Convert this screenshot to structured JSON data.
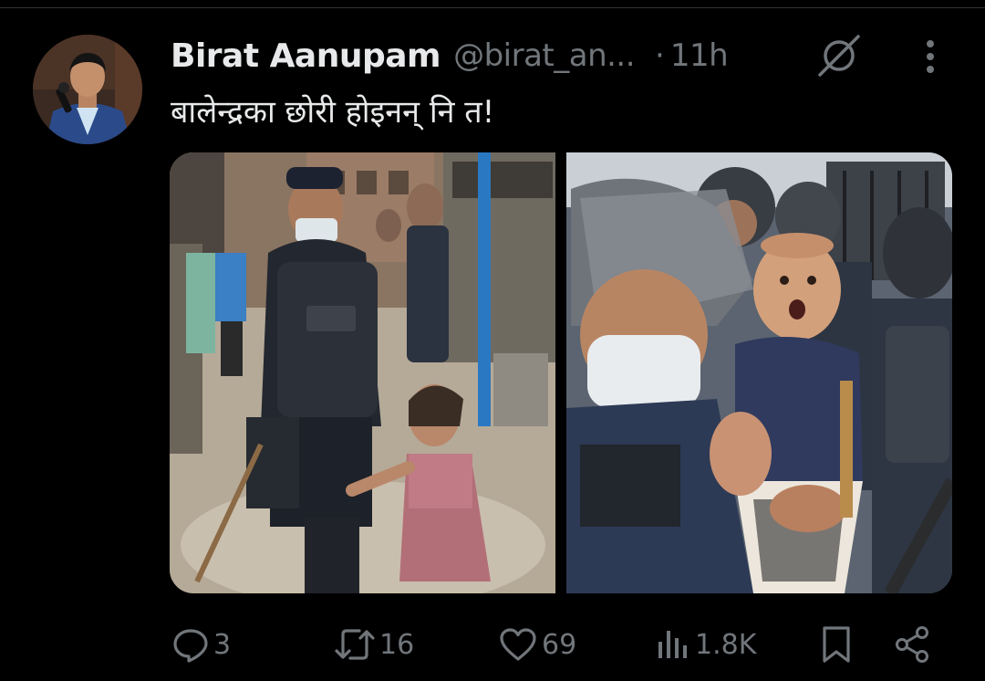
{
  "tweet": {
    "display_name": "Birat Aanupam",
    "handle": "@birat_an...",
    "separator": "·",
    "time": "11h",
    "text": "बालेन्द्रका छोरी होइनन् नि त!"
  },
  "actions": {
    "replies": "3",
    "reposts": "16",
    "likes": "69",
    "views": "1.8K"
  },
  "icons": {
    "avatar": "avatar",
    "grok": "slashed-circle-icon",
    "more": "more-vertical-icon",
    "reply": "reply-icon",
    "repost": "repost-icon",
    "like": "heart-icon",
    "views": "views-icon",
    "bookmark": "bookmark-icon",
    "share": "share-icon"
  },
  "colors": {
    "background": "#000000",
    "primary_text": "#e7e9ea",
    "secondary_text": "#71767b",
    "divider": "#2f3336"
  }
}
